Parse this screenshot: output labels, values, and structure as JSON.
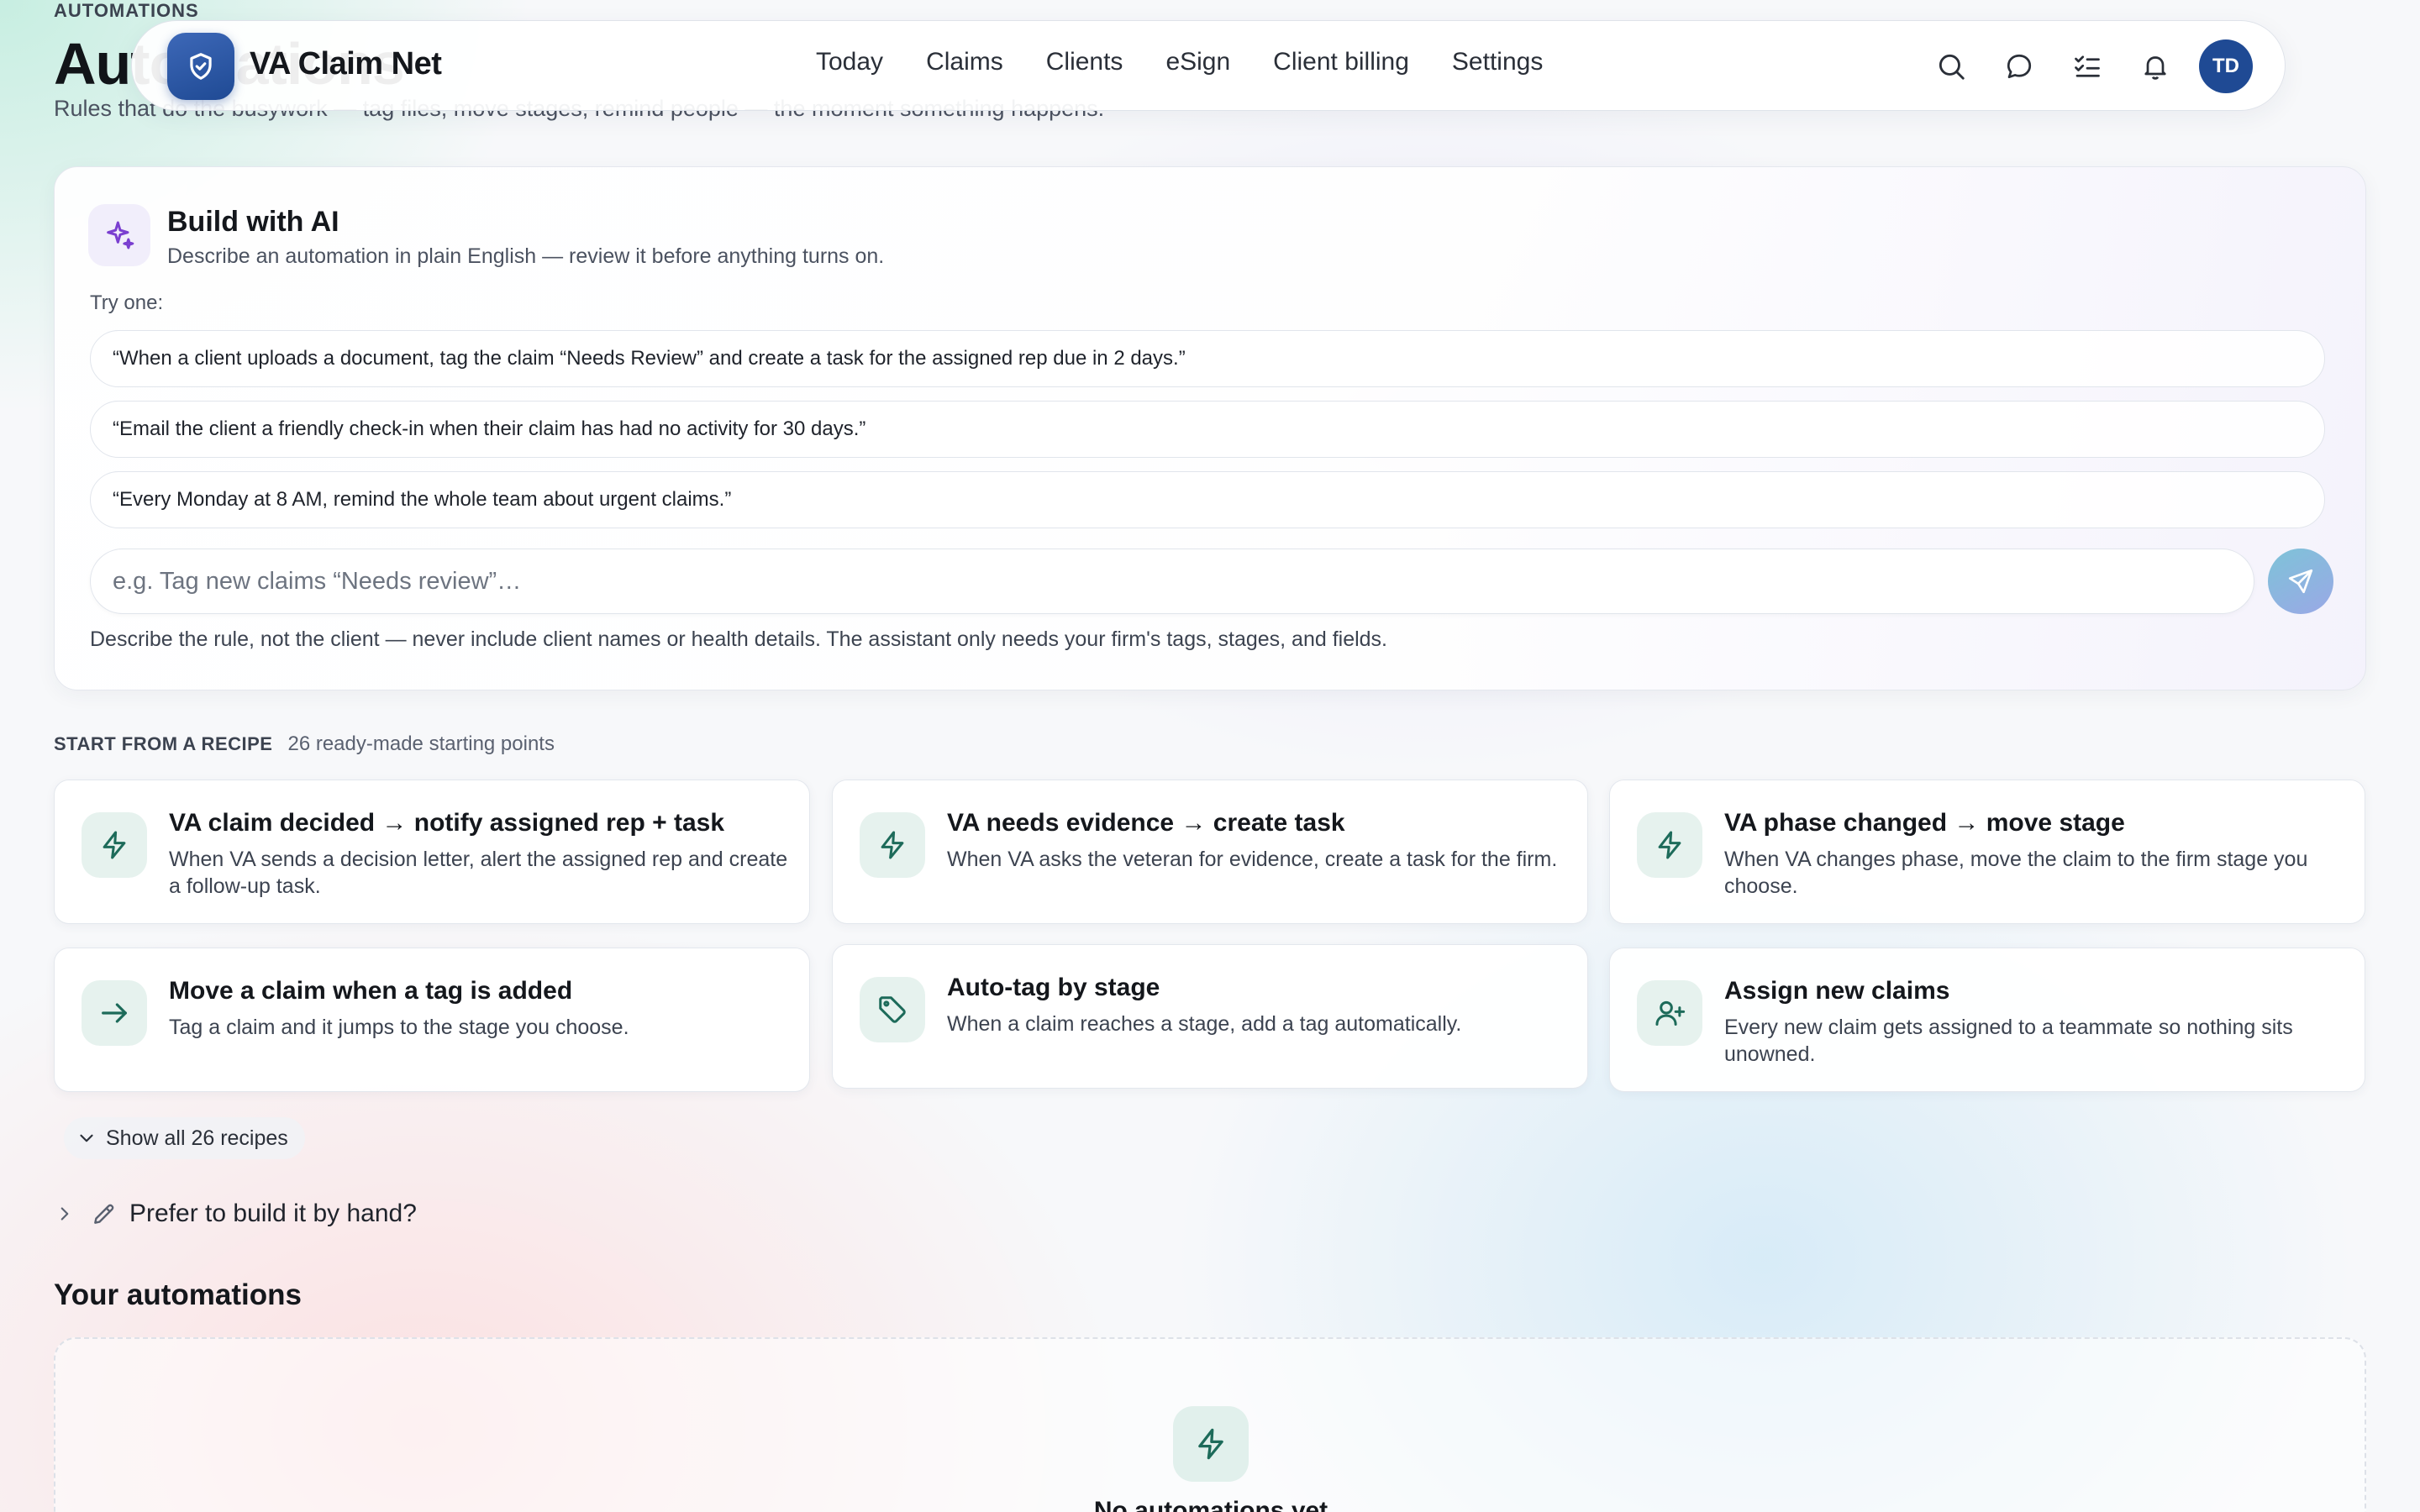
{
  "page": {
    "eyebrow": "AUTOMATIONS",
    "title": "Automations",
    "subtitle": "Rules that do the busywork — tag files, move stages, remind people — the moment something happens."
  },
  "nav": {
    "brand": "VA Claim Net",
    "links": [
      "Today",
      "Claims",
      "Clients",
      "eSign",
      "Client billing",
      "Settings"
    ],
    "icons": [
      "search-icon",
      "chat-icon",
      "tasks-icon",
      "bell-icon"
    ],
    "avatar_initials": "TD"
  },
  "ai_builder": {
    "title": "Build with AI",
    "description": "Describe an automation in plain English — review it before anything turns on.",
    "try_label": "Try one:",
    "suggestions": [
      "“When a client uploads a document, tag the claim “Needs Review” and create a task for the assigned rep due in 2 days.”",
      "“Email the client a friendly check-in when their claim has had no activity for 30 days.”",
      "“Every Monday at 8 AM, remind the whole team about urgent claims.”"
    ],
    "input_placeholder": "e.g. Tag new claims “Needs review”…",
    "privacy_note": "Describe the rule, not the client — never include client names or health details. The assistant only needs your firm's tags, stages, and fields."
  },
  "recipes": {
    "label": "START FROM A RECIPE",
    "count": "26 ready-made starting points",
    "items": [
      {
        "title": "VA claim decided → notify assigned rep + task",
        "desc": "When VA sends a decision letter, alert the assigned rep and create a follow-up task.",
        "icon": "lightning-icon"
      },
      {
        "title": "VA needs evidence → create task",
        "desc": "When VA asks the veteran for evidence, create a task for the firm.",
        "icon": "lightning-icon"
      },
      {
        "title": "VA phase changed → move stage",
        "desc": "When VA changes phase, move the claim to the firm stage you choose.",
        "icon": "lightning-icon"
      },
      {
        "title": "Move a claim when a tag is added",
        "desc": "Tag a claim and it jumps to the stage you choose.",
        "icon": "arrow-right-icon"
      },
      {
        "title": "Auto-tag by stage",
        "desc": "When a claim reaches a stage, add a tag automatically.",
        "icon": "tag-icon"
      },
      {
        "title": "Assign new claims",
        "desc": "Every new claim gets assigned to a teammate so nothing sits unowned.",
        "icon": "user-plus-icon"
      }
    ],
    "show_all": "Show all 26 recipes"
  },
  "manual": {
    "label": "Prefer to build it by hand?"
  },
  "your_automations": {
    "title": "Your automations",
    "empty_text": "No automations yet"
  },
  "colors": {
    "accent_green": "#1d6b5a",
    "brand_blue": "#1f4a94",
    "ai_purple": "#7a3fd0"
  }
}
